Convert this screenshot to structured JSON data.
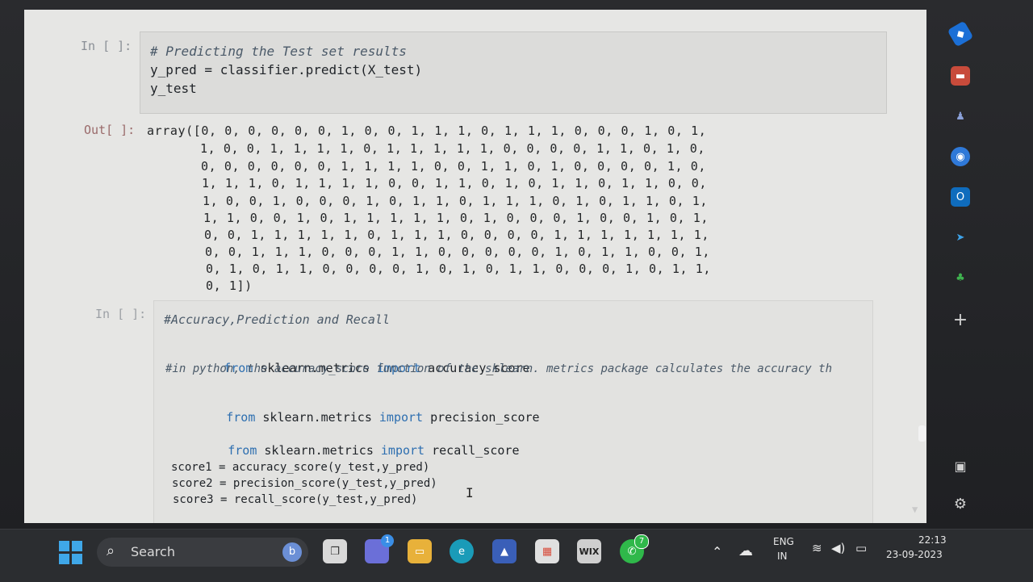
{
  "cells": [
    {
      "prompt": "In [ ]:",
      "lines": [
        {
          "type": "comment",
          "text": "# Predicting the Test set results"
        },
        {
          "type": "code",
          "text": "y_pred = classifier.predict(X_test)"
        },
        {
          "type": "code",
          "text": "y_test"
        }
      ]
    },
    {
      "prompt": "Out[ ]:",
      "output_lines": [
        "array([0, 0, 0, 0, 0, 0, 1, 0, 0, 1, 1, 1, 0, 1, 1, 1, 0, 0, 0, 1, 0, 1,",
        "1, 0, 0, 1, 1, 1, 1, 0, 1, 1, 1, 1, 1, 0, 0, 0, 0, 1, 1, 0, 1, 0,",
        "0, 0, 0, 0, 0, 0, 1, 1, 1, 1, 0, 0, 1, 1, 0, 1, 0, 0, 0, 0, 1, 0,",
        "1, 1, 1, 0, 1, 1, 1, 1, 0, 0, 1, 1, 0, 1, 0, 1, 1, 0, 1, 1, 0, 0,",
        "1, 0, 0, 1, 0, 0, 0, 1, 0, 1, 1, 0, 1, 1, 1, 0, 1, 0, 1, 1, 0, 1,",
        "1, 1, 0, 0, 1, 0, 1, 1, 1, 1, 1, 0, 1, 0, 0, 0, 1, 0, 0, 1, 0, 1,",
        "0, 0, 1, 1, 1, 1, 1, 0, 1, 1, 1, 0, 0, 0, 0, 1, 1, 1, 1, 1, 1, 1,",
        "0, 0, 1, 1, 1, 0, 0, 0, 1, 1, 0, 0, 0, 0, 0, 1, 0, 1, 1, 0, 0, 1,",
        "0, 1, 0, 1, 1, 0, 0, 0, 0, 1, 0, 1, 0, 1, 1, 0, 0, 0, 1, 0, 1, 1,",
        "0, 1])"
      ]
    },
    {
      "prompt": "In [ ]:",
      "lines": [
        {
          "type": "comment",
          "text": "#Accuracy,Prediction and Recall"
        },
        {
          "kw1": "from",
          "mod": " sklearn.metrics ",
          "kw2": "import",
          "name": " accuracy_score"
        },
        {
          "type": "comment",
          "text": "#in python, the accuracy_score function of the sklearn. metrics package calculates the accuracy th"
        },
        {
          "kw1": "from",
          "mod": " sklearn.metrics ",
          "kw2": "import",
          "name": " precision_score"
        },
        {
          "kw1": "from",
          "mod": " sklearn.metrics ",
          "kw2": "import",
          "name": " recall_score"
        },
        {
          "type": "code",
          "text": "score1 = accuracy_score(y_test,y_pred)"
        },
        {
          "type": "code",
          "text": "score2 = precision_score(y_test,y_pred)"
        },
        {
          "type": "code",
          "text": "score3 = recall_score(y_test,y_pred)"
        }
      ]
    }
  ],
  "taskbar": {
    "search_label": "Search",
    "wix_label": "WIX",
    "teams_badge": "1",
    "whatsapp_badge": "7",
    "lang_top": "ENG",
    "lang_bottom": "IN",
    "time": "22:13",
    "date": "23-09-2023"
  },
  "dock": {
    "add_label": "+"
  },
  "colors": {
    "accent": "#3fa7e8",
    "keyword": "#2e6fb0",
    "taskbar": "#2b2d30"
  }
}
